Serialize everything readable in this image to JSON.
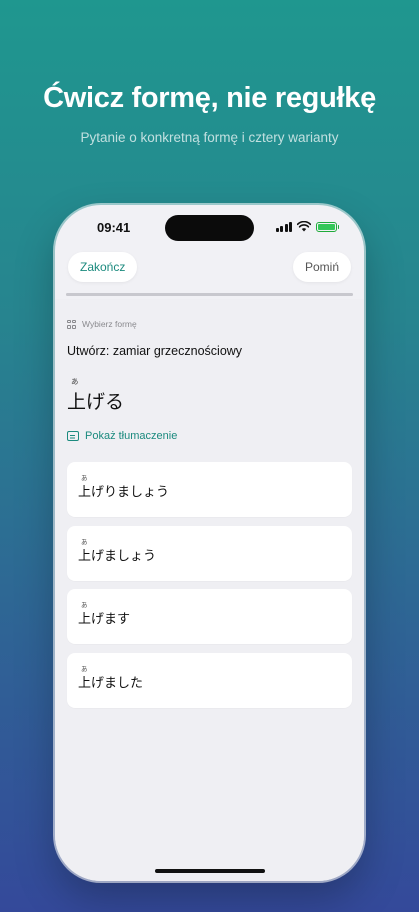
{
  "marketing": {
    "headline": "Ćwicz formę, nie regułkę",
    "subline": "Pytanie o konkretną formę i cztery warianty"
  },
  "status_bar": {
    "time": "09:41"
  },
  "toolbar": {
    "end_label": "Zakończ",
    "skip_label": "Pomiń"
  },
  "progress": {
    "fraction": 1.0
  },
  "question": {
    "section_label": "Wybierz formę",
    "prompt": "Utwórz: zamiar grzecznościowy",
    "furigana": "あ",
    "word": "上げる",
    "show_translation_label": "Pokaż tłumaczenie"
  },
  "options": [
    {
      "furigana": "あ",
      "text": "上げりましょう"
    },
    {
      "furigana": "あ",
      "text": "上げましょう"
    },
    {
      "furigana": "あ",
      "text": "上げます"
    },
    {
      "furigana": "あ",
      "text": "上げました"
    }
  ],
  "colors": {
    "accent": "#1b8a7e",
    "battery": "#34c759"
  },
  "icons": [
    "signal-icon",
    "wifi-icon",
    "battery-icon",
    "grid-icon",
    "speech-bubble-icon"
  ]
}
